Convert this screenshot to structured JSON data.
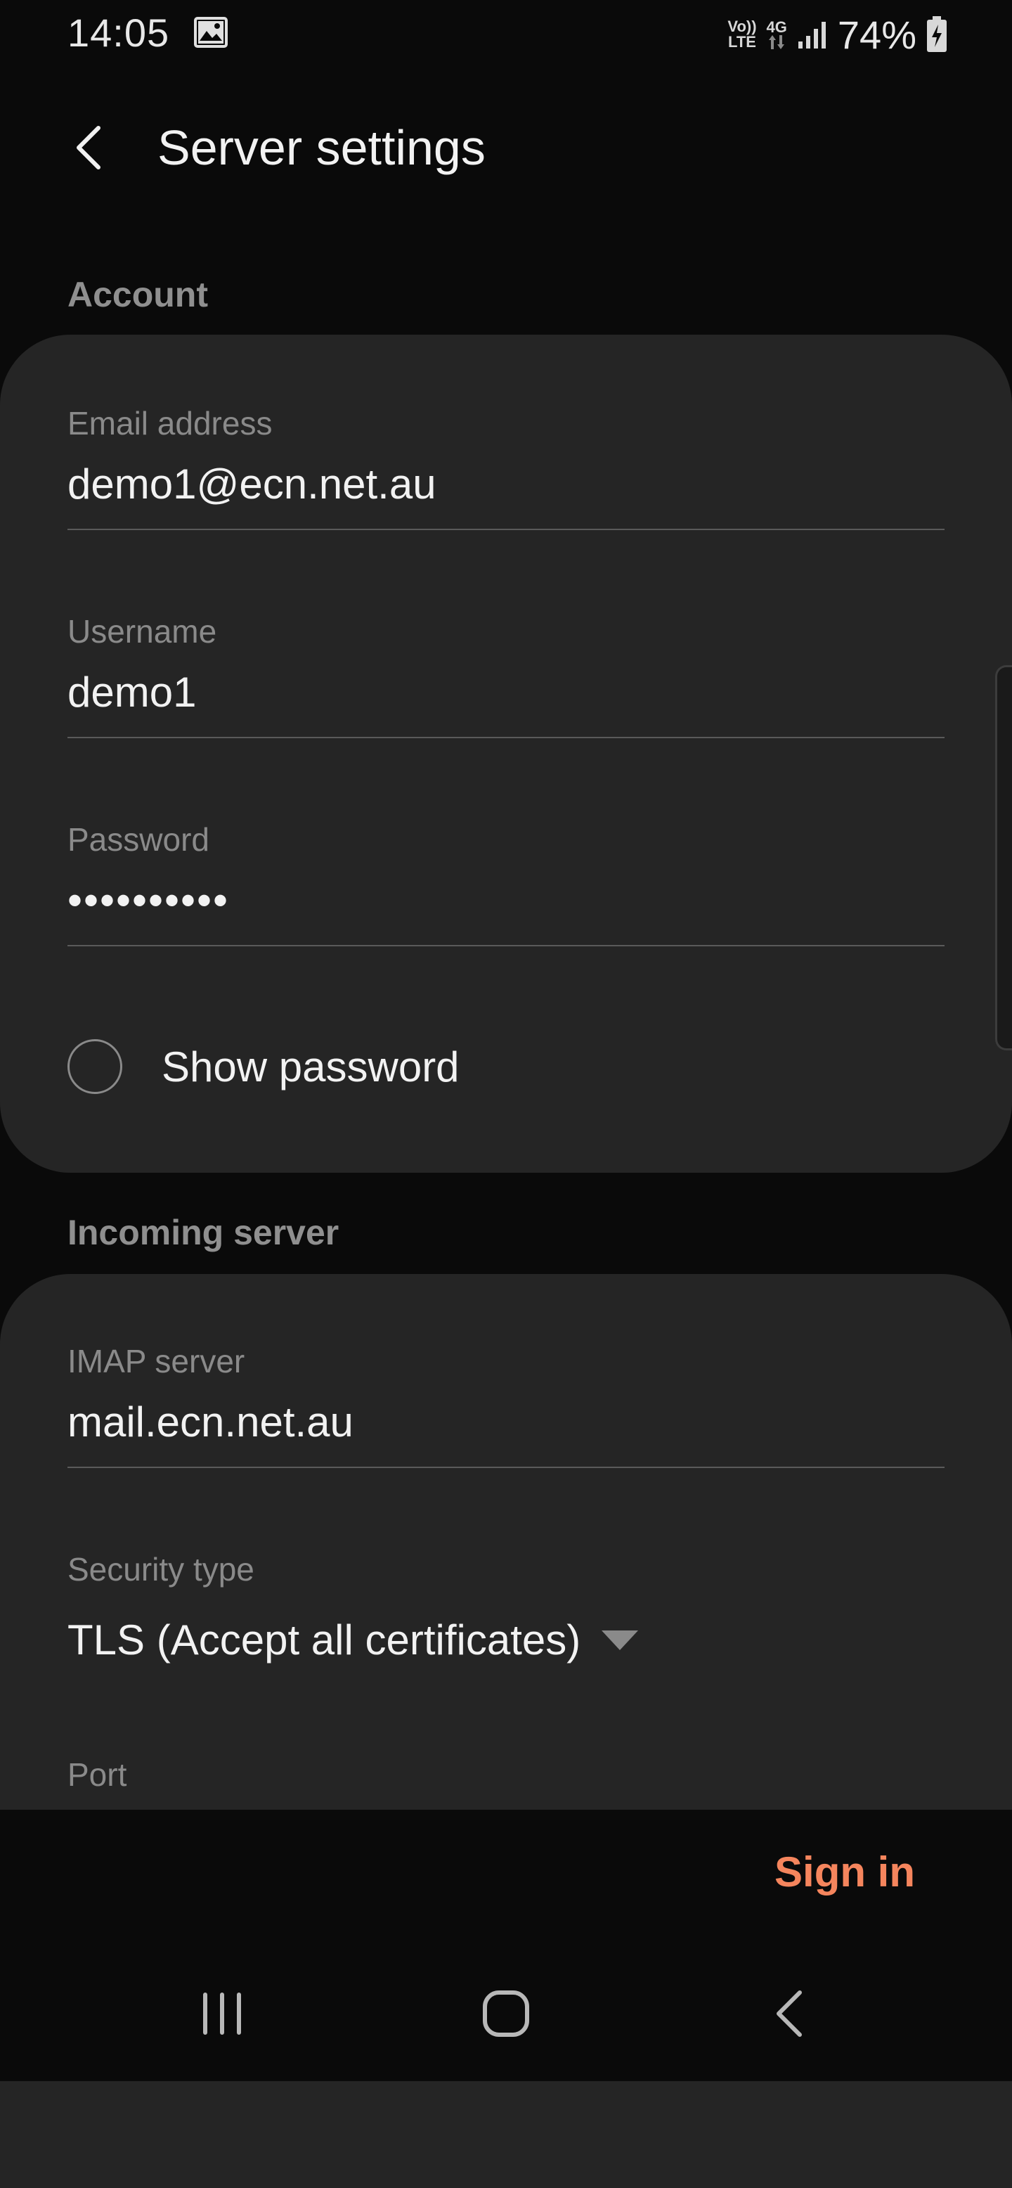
{
  "status_bar": {
    "time": "14:05",
    "volte_top": "Vo))",
    "volte_bottom": "LTE",
    "network": "4G",
    "battery": "74%"
  },
  "header": {
    "title": "Server settings"
  },
  "account": {
    "section_title": "Account",
    "email_label": "Email address",
    "email_value": "demo1@ecn.net.au",
    "username_label": "Username",
    "username_value": "demo1",
    "password_label": "Password",
    "password_value": "••••••••••",
    "show_password_label": "Show password",
    "show_password_checked": false
  },
  "incoming": {
    "section_title": "Incoming server",
    "imap_label": "IMAP server",
    "imap_value": "mail.ecn.net.au",
    "security_label": "Security type",
    "security_value": "TLS (Accept all certificates)",
    "port_label": "Port"
  },
  "actions": {
    "sign_in": "Sign in"
  },
  "colors": {
    "accent": "#f5855d",
    "background": "#0a0a0a",
    "card": "#252525"
  }
}
